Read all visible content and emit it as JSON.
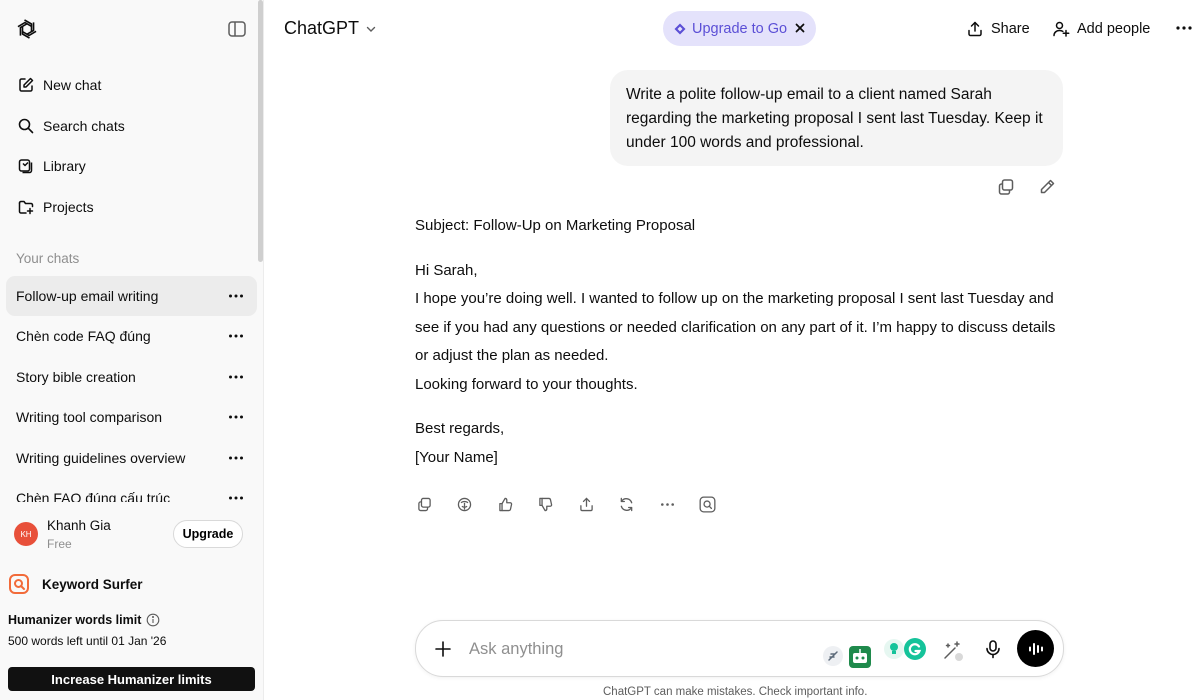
{
  "sidebar": {
    "nav": [
      {
        "label": "New chat",
        "icon": "edit-icon"
      },
      {
        "label": "Search chats",
        "icon": "search-icon"
      },
      {
        "label": "Library",
        "icon": "library-icon"
      },
      {
        "label": "Projects",
        "icon": "folder-plus-icon"
      }
    ],
    "section_label": "Your chats",
    "chats": [
      {
        "label": "Follow-up email writing",
        "active": true
      },
      {
        "label": "Chèn code FAQ đúng"
      },
      {
        "label": "Story bible creation"
      },
      {
        "label": "Writing tool comparison"
      },
      {
        "label": "Writing guidelines overview"
      },
      {
        "label": "Chèn FAQ đúng cấu trúc"
      }
    ],
    "user": {
      "initials": "KH",
      "name": "Khanh Gia",
      "plan": "Free",
      "upgrade_label": "Upgrade"
    },
    "extension": {
      "name": "Keyword Surfer"
    },
    "humanizer": {
      "title": "Humanizer words limit",
      "subtitle": "500 words left until 01 Jan '26",
      "button_label": "Increase Humanizer limits"
    }
  },
  "header": {
    "model": "ChatGPT",
    "upgrade_label": "Upgrade to Go",
    "share_label": "Share",
    "add_people_label": "Add people"
  },
  "conversation": {
    "user_message": "Write a polite follow-up email to a client named Sarah regarding the marketing proposal I sent last Tuesday. Keep it under 100 words and professional.",
    "assistant": {
      "subject": "Subject: Follow-Up on Marketing Proposal",
      "greeting": "Hi Sarah,",
      "body": "I hope you’re doing well. I wanted to follow up on the marketing proposal I sent last Tuesday and see if you had any questions or needed clarification on any part of it. I’m happy to discuss details or adjust the plan as needed.",
      "closing_line": "Looking forward to your thoughts.",
      "signoff": "Best regards,",
      "signature": "[Your Name]"
    }
  },
  "composer": {
    "placeholder": "Ask anything"
  },
  "footer": {
    "note": "ChatGPT can make mistakes. Check important info."
  },
  "colors": {
    "accent_purple": "#5b4fd6",
    "upgrade_pill_bg": "#e4e2fb",
    "avatar_bg": "#e8503a",
    "grammarly_green": "#15c39a"
  }
}
